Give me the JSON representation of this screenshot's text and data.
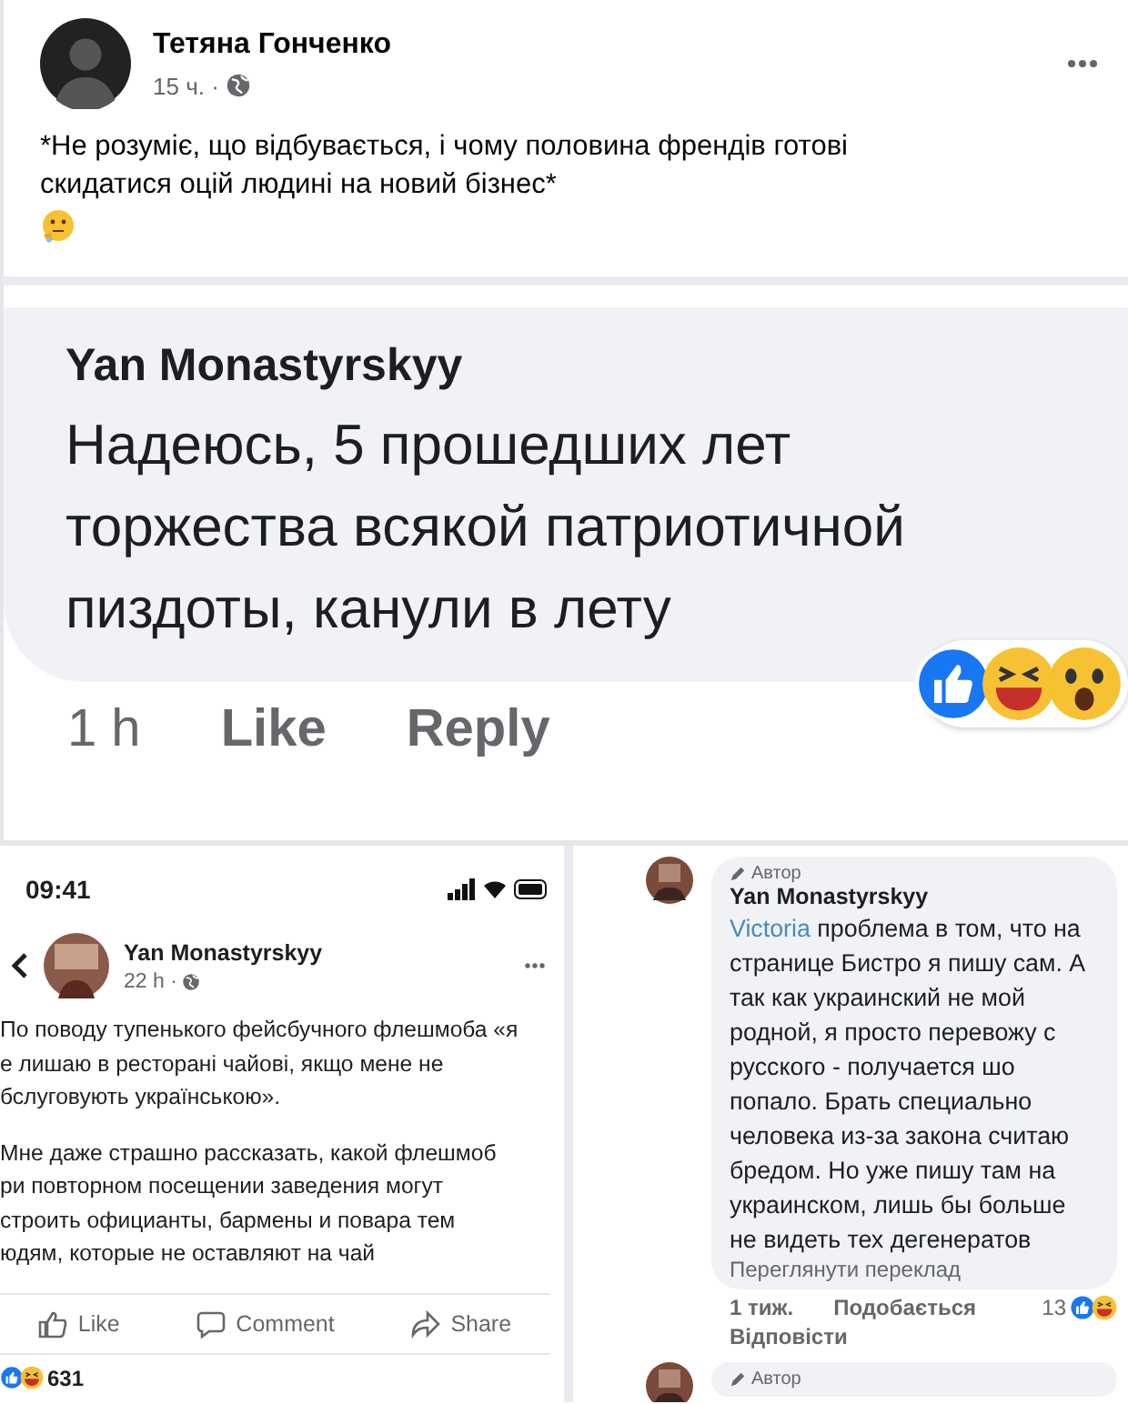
{
  "post": {
    "author": "Тетяна Гонченко",
    "time": "15 ч. ·",
    "text": "*Не розуміє, що відбувається, і чому половина френдів готові скидатися оцій людині на новий бізнес*"
  },
  "big_comment": {
    "author": "Yan Monastyrskyy",
    "lines": [
      "Надеюсь, 5 прошедших лет",
      "торжества всякой патриотичной",
      "пиздоты, канули в лету"
    ],
    "time": "1 h",
    "actions": [
      "Like",
      "Reply"
    ]
  },
  "phone_post": {
    "status_time": "09:41",
    "author": "Yan Monastyrskyy",
    "time": "22 h ·",
    "paragraphs": [
      [
        "По поводу тупенького фейсбучного флешмоба «я",
        "е лишаю в ресторані чайові, якщо мене не",
        "бслуговують українською»."
      ],
      [
        "Мне даже страшно рассказать, какой флешмоб",
        "ри повторном посещении заведения могут",
        "строить официанты, бармены и повара тем",
        "юдям, которые не оставляют на чай"
      ]
    ],
    "actions": [
      "Like",
      "Comment",
      "Share"
    ],
    "reaction_count": "631"
  },
  "reply_comments": [
    {
      "badge": "Автор",
      "author": "Yan Monastyrskyy",
      "mention": "Victoria",
      "text": "проблема в том, что на странице Бистро я пишу сам. А так как украинский не мой родной, я просто перевожу с русского - получается шо попало. Брать специально человека из-за закона считаю бредом. Но уже пишу там на украинском, лишь бы больше не видеть тех дегенератов",
      "translate": "Переглянути переклад",
      "time": "1 тиж.",
      "like": "Подобається",
      "reaction_count": "13",
      "reply": "Відповісти"
    },
    {
      "badge": "Автор"
    }
  ]
}
